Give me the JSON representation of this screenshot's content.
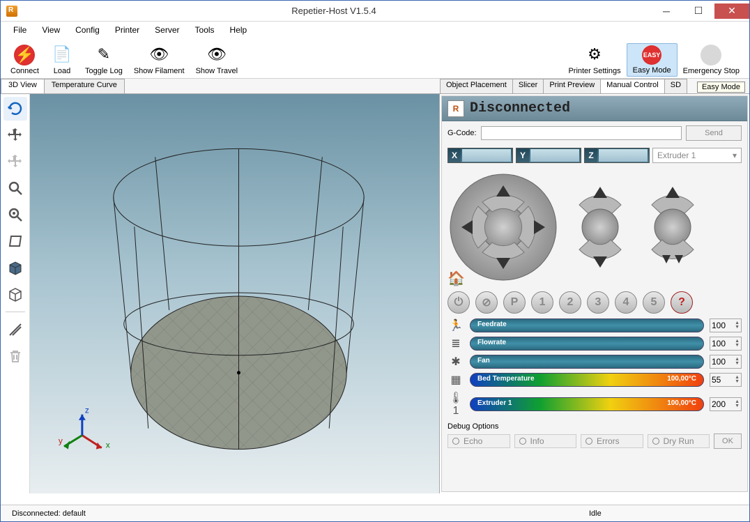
{
  "title": "Repetier-Host V1.5.4",
  "menus": [
    "File",
    "View",
    "Config",
    "Printer",
    "Server",
    "Tools",
    "Help"
  ],
  "toolbar": {
    "connect": "Connect",
    "load": "Load",
    "toggle_log": "Toggle Log",
    "show_filament": "Show Filament",
    "show_travel": "Show Travel",
    "printer_settings": "Printer Settings",
    "easy_mode": "Easy Mode",
    "emergency_stop": "Emergency Stop"
  },
  "left_tabs": {
    "view3d": "3D View",
    "temp": "Temperature Curve"
  },
  "right_tabs": {
    "object": "Object Placement",
    "slicer": "Slicer",
    "preview": "Print Preview",
    "manual": "Manual Control",
    "sd": "SD"
  },
  "tooltip": "Easy Mode",
  "status_label": "Disconnected",
  "gcode_label": "G-Code:",
  "send_label": "Send",
  "axes": {
    "x": "X",
    "y": "Y",
    "z": "Z"
  },
  "extruder_select": "Extruder 1",
  "preset_labels": [
    "P",
    "1",
    "2",
    "3",
    "4",
    "5",
    "?"
  ],
  "sliders": {
    "feedrate": {
      "label": "Feedrate",
      "value": "100"
    },
    "flowrate": {
      "label": "Flowrate",
      "value": "100"
    },
    "fan": {
      "label": "Fan",
      "value": "100"
    },
    "bed": {
      "label": "Bed Temperature",
      "reading": "100,00°C",
      "value": "55"
    },
    "extruder": {
      "label": "Extruder 1",
      "reading": "100,00°C",
      "value": "200"
    }
  },
  "debug": {
    "title": "Debug Options",
    "echo": "Echo",
    "info": "Info",
    "errors": "Errors",
    "dryrun": "Dry Run",
    "ok": "OK"
  },
  "statusbar": {
    "conn": "Disconnected: default",
    "idle": "Idle"
  }
}
